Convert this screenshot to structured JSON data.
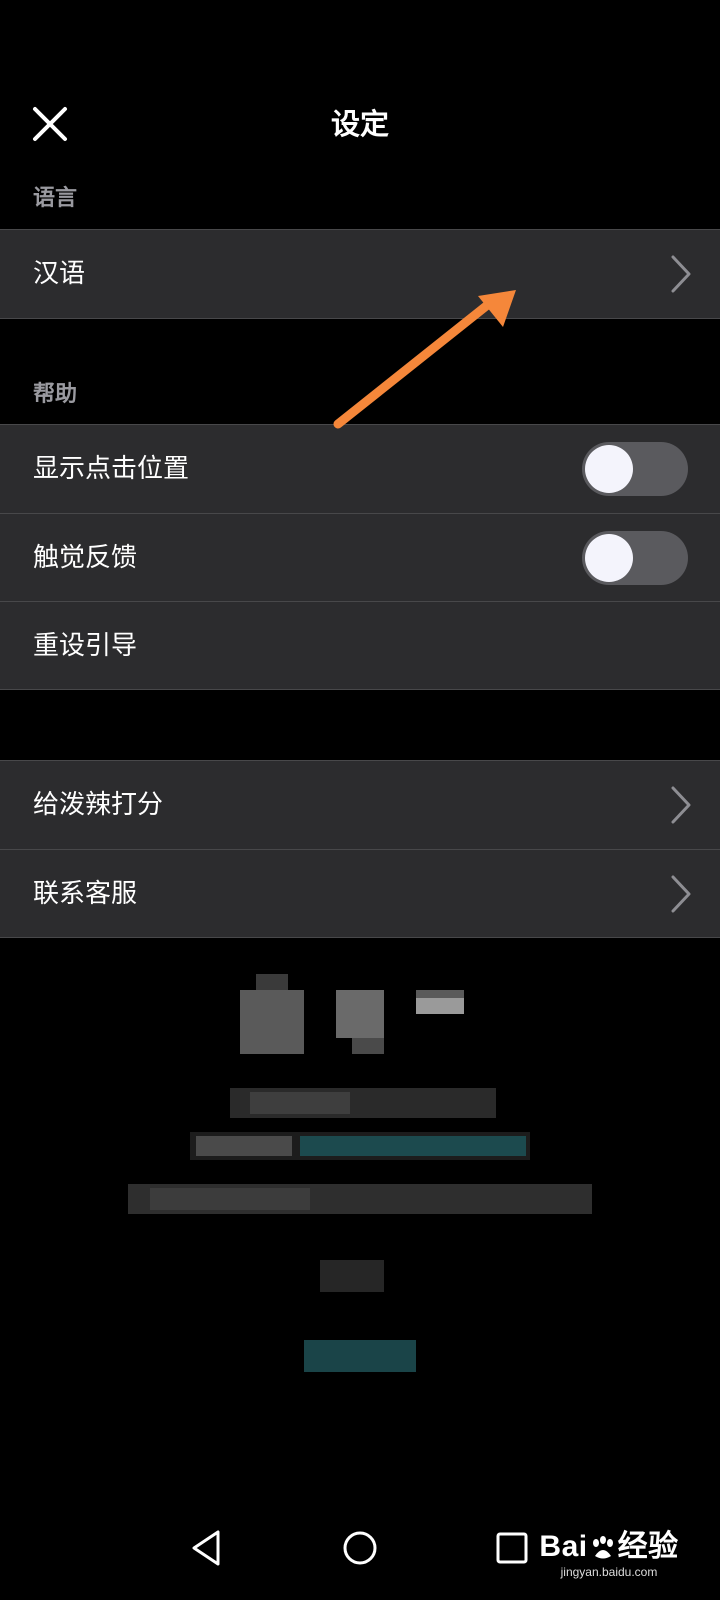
{
  "header": {
    "title": "设定",
    "close_icon": "close-icon"
  },
  "language_section": {
    "label": "语言",
    "items": [
      {
        "label": "汉语",
        "type": "link",
        "icon": "chevron-right-icon"
      }
    ]
  },
  "help_section": {
    "label": "帮助",
    "items": [
      {
        "label": "显示点击位置",
        "type": "toggle",
        "on": false
      },
      {
        "label": "触觉反馈",
        "type": "toggle",
        "on": false
      },
      {
        "label": "重设引导",
        "type": "action"
      }
    ]
  },
  "other_section": {
    "items": [
      {
        "label": "给泼辣打分",
        "type": "link",
        "icon": "chevron-right-icon"
      },
      {
        "label": "联系客服",
        "type": "link",
        "icon": "chevron-right-icon"
      }
    ]
  },
  "annotation": {
    "arrow_color": "#f5873a"
  },
  "navigation_bar": {
    "buttons": [
      "back-triangle-icon",
      "home-circle-icon",
      "recents-square-icon"
    ]
  },
  "watermark": {
    "logo_left": "Bai",
    "logo_right": "经验",
    "url": "jingyan.baidu.com"
  },
  "colors": {
    "background": "#000000",
    "row_background": "#2c2c2e",
    "divider": "#48484a",
    "section_label": "#9a9aa0",
    "toggle_track_off": "#5a5a5e",
    "toggle_knob": "#f4f4fc"
  }
}
